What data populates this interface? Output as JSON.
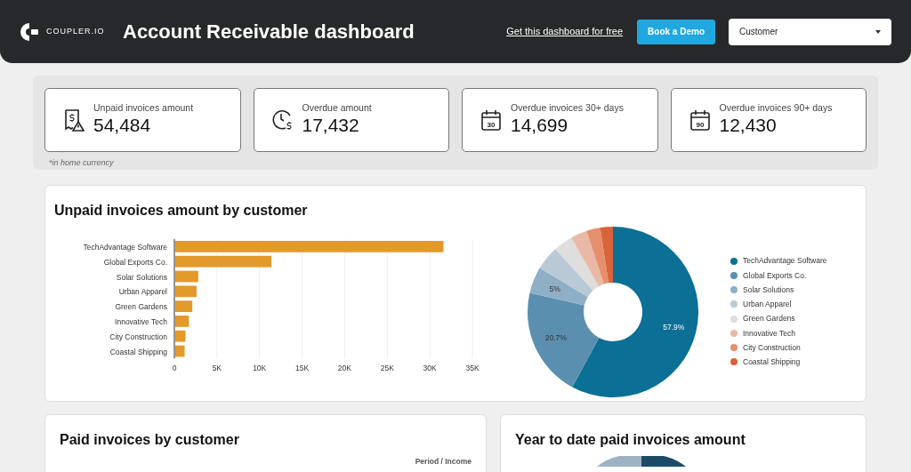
{
  "header": {
    "logo_text": "COUPLER.IO",
    "title": "Account Receivable dashboard",
    "link": "Get this dashboard for free",
    "button": "Book a Demo",
    "filter": {
      "value": "Customer"
    }
  },
  "kpis": [
    {
      "kind": "receipt",
      "label": "Unpaid invoices amount",
      "value": "54,484"
    },
    {
      "kind": "clock",
      "label": "Overdue amount",
      "value": "17,432"
    },
    {
      "kind": "calendar",
      "icon_text": "30",
      "label": "Overdue invoices 30+ days",
      "value": "14,699"
    },
    {
      "kind": "calendar",
      "icon_text": "90",
      "label": "Overdue invoices 90+ days",
      "value": "12,430"
    }
  ],
  "kpi_note": "*in home currency",
  "unpaid_by_customer": {
    "title": "Unpaid invoices amount by customer",
    "bar_chart": {
      "chart_data": {
        "type": "bar",
        "orientation": "horizontal",
        "categories": [
          "TechAdvantage Software",
          "Global Exports Co.",
          "Solar Solutions",
          "Urban Apparel",
          "Green Gardens",
          "Innovative Tech",
          "City Construction",
          "Coastal Shipping"
        ],
        "series": [
          {
            "color": "#e39a2b",
            "values": [
              31500,
              11300,
              2700,
              2500,
              2000,
              1600,
              1200,
              1100
            ]
          }
        ],
        "grid": true,
        "xlim": [
          0,
          35000
        ],
        "xticks": [
          {
            "value": 0,
            "label": "0"
          },
          {
            "value": 5000,
            "label": "5K"
          },
          {
            "value": 10000,
            "label": "10K"
          },
          {
            "value": 15000,
            "label": "15K"
          },
          {
            "value": 20000,
            "label": "20K"
          },
          {
            "value": 25000,
            "label": "25K"
          },
          {
            "value": 30000,
            "label": "30K"
          },
          {
            "value": 35000,
            "label": "35K"
          }
        ]
      }
    },
    "donut_chart": {
      "chart_data": {
        "type": "donut",
        "categories": [
          "TechAdvantage Software",
          "Global Exports Co.",
          "Solar Solutions",
          "Urban Apparel",
          "Green Gardens",
          "Innovative Tech",
          "City Construction",
          "Coastal Shipping"
        ],
        "series": [
          {
            "values": [
              57.9,
              20.7,
              5,
              4.6,
              3.7,
              3.1,
              2.6,
              2.4
            ]
          }
        ],
        "colors": [
          "#0c6f96",
          "#5a8fb0",
          "#8eafc6",
          "#b9c9d6",
          "#dedede",
          "#eab9a6",
          "#e58f6e",
          "#d9633a"
        ],
        "value_labels": [
          "57.9%",
          "20.7%",
          "5%",
          null,
          null,
          null,
          null,
          null
        ]
      }
    }
  },
  "paid_by_customer": {
    "title": "Paid invoices by customer",
    "column_header": "Period / Income"
  },
  "ytd_paid": {
    "title": "Year to date paid invoices amount"
  }
}
